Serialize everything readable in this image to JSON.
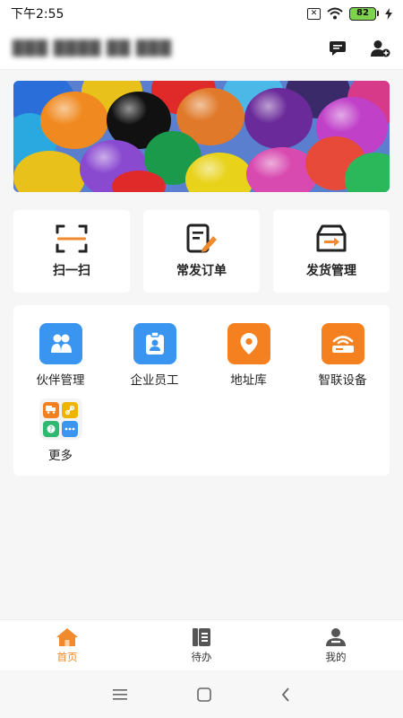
{
  "status_bar": {
    "time": "下午2:55",
    "battery": "82"
  },
  "header": {
    "company_name": "███ ████ ██ ███",
    "icons": [
      "chat-icon",
      "add-user-icon"
    ]
  },
  "quick_actions": [
    {
      "label": "扫一扫",
      "icon": "scan-icon"
    },
    {
      "label": "常发订单",
      "icon": "order-edit-icon"
    },
    {
      "label": "发货管理",
      "icon": "shipping-box-icon"
    }
  ],
  "grid": {
    "items": [
      {
        "label": "伙伴管理",
        "icon": "partners-icon",
        "color": "#3a95f0"
      },
      {
        "label": "企业员工",
        "icon": "employee-badge-icon",
        "color": "#3a95f0"
      },
      {
        "label": "地址库",
        "icon": "location-pin-icon",
        "color": "#f5801f"
      },
      {
        "label": "智联设备",
        "icon": "router-device-icon",
        "color": "#f5801f"
      }
    ],
    "more_label": "更多",
    "more_colors": [
      "#f5801f",
      "#f0b400",
      "#2eb872",
      "#3a95f0"
    ]
  },
  "tabs": [
    {
      "label": "首页",
      "icon": "home-icon",
      "active": true
    },
    {
      "label": "待办",
      "icon": "todo-list-icon",
      "active": false
    },
    {
      "label": "我的",
      "icon": "profile-icon",
      "active": false
    }
  ],
  "colors": {
    "accent": "#f08a2c",
    "blue": "#3a95f0",
    "orange": "#f5801f"
  }
}
